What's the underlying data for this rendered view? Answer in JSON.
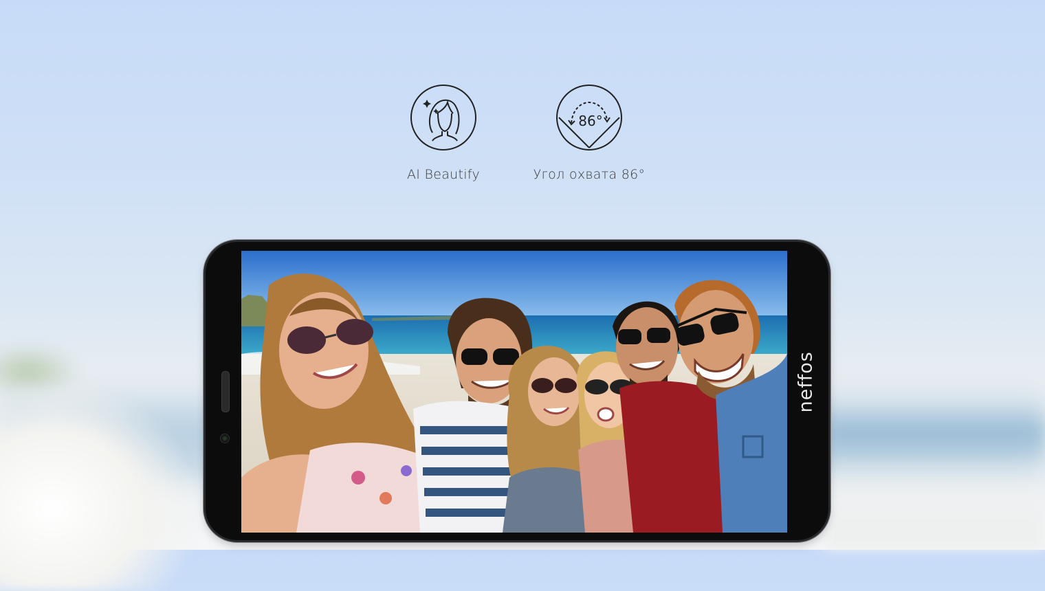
{
  "features": [
    {
      "icon": "ai-beautify-face-icon",
      "label": "AI Beautify"
    },
    {
      "icon": "wide-angle-86-icon",
      "label": "Угол охвата 86°",
      "icon_text": "86°"
    }
  ],
  "phone": {
    "brand": "neffos",
    "screen_content": "group-selfie-beach-photo"
  },
  "colors": {
    "sky_top": "#c7dbf8",
    "icon_stroke": "#222222",
    "label_text": "#3a3a3a",
    "phone_body": "#0c0c0c"
  }
}
